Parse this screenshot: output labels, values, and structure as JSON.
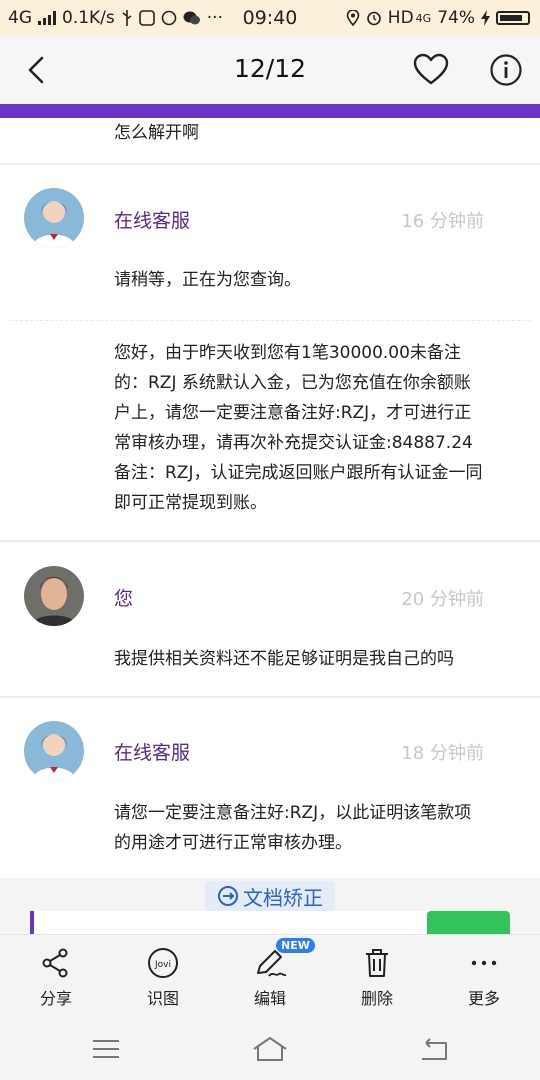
{
  "status_bar": {
    "network": "4G",
    "speed": "0.1K/s",
    "time": "09:40",
    "hd": "HD",
    "net2": "4G",
    "battery": "74%"
  },
  "header": {
    "counter": "12/12"
  },
  "messages": {
    "prev_tail": "怎么解开啊",
    "group1": {
      "name": "在线客服",
      "time": "16 分钟前",
      "text1": "请稍等，正在为您查询。",
      "text2": "您好，由于昨天收到您有1笔30000.00未备注的：RZJ 系统默认入金，已为您充值在你余额账户上，请您一定要注意备注好:RZJ，才可进行正常审核办理，请再次补充提交认证金:84887.24备注：RZJ，认证完成返回账户跟所有认证金一同即可正常提现到账。"
    },
    "group2": {
      "name": "您",
      "time": "20 分钟前",
      "text": "我提供相关资料还不能足够证明是我自己的吗"
    },
    "group3": {
      "name": "在线客服",
      "time": "18 分钟前",
      "text": "请您一定要注意备注好:RZJ，以此证明该笔款项的用途才可进行正常审核办理。"
    }
  },
  "doc_correct": {
    "label": "文档矫正"
  },
  "toolbar": {
    "share": "分享",
    "recognize": "识图",
    "recognize_icon_text": "Jovi",
    "edit": "编辑",
    "edit_badge": "NEW",
    "delete": "删除",
    "more": "更多"
  }
}
